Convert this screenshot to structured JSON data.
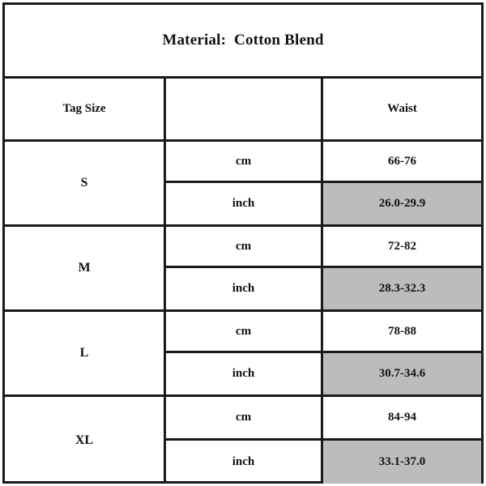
{
  "title": "Material:  Cotton Blend",
  "columns": {
    "tag_size": "Tag Size",
    "unit": "",
    "waist": "Waist"
  },
  "units": {
    "cm": "cm",
    "inch": "inch"
  },
  "colors": {
    "border": "#1a1a1a",
    "shaded_cell": "#bcbcbc",
    "background": "#ffffff",
    "text": "#121212"
  },
  "rows": [
    {
      "tag_size": "S",
      "cm_unit": "cm",
      "cm_waist": "66-76",
      "inch_unit": "inch",
      "inch_waist": "26.0-29.9"
    },
    {
      "tag_size": "M",
      "cm_unit": "cm",
      "cm_waist": "72-82",
      "inch_unit": "inch",
      "inch_waist": "28.3-32.3"
    },
    {
      "tag_size": "L",
      "cm_unit": "cm",
      "cm_waist": "78-88",
      "inch_unit": "inch",
      "inch_waist": "30.7-34.6"
    },
    {
      "tag_size": "XL",
      "cm_unit": "cm",
      "cm_waist": "84-94",
      "inch_unit": "inch",
      "inch_waist": "33.1-37.0"
    }
  ],
  "chart_data": {
    "type": "table",
    "title": "Material:  Cotton Blend",
    "columns": [
      "Tag Size",
      "",
      "Waist"
    ],
    "categories": [
      "S",
      "M",
      "L",
      "XL"
    ],
    "series": [
      {
        "name": "Waist (cm)",
        "values": [
          "66-76",
          "72-82",
          "78-88",
          "84-94"
        ]
      },
      {
        "name": "Waist (inch)",
        "values": [
          "26.0-29.9",
          "28.3-32.3",
          "30.7-34.6",
          "33.1-37.0"
        ]
      }
    ],
    "xlabel": "",
    "ylabel": "",
    "grid": true,
    "legend": "none"
  }
}
